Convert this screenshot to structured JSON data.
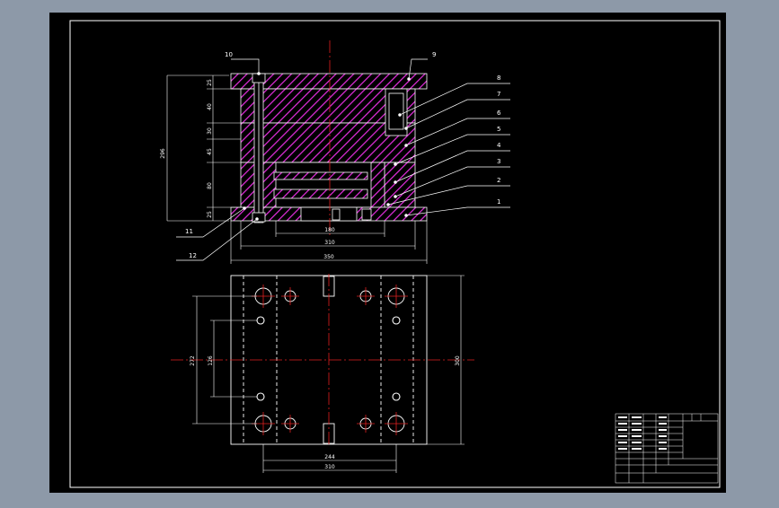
{
  "colors": {
    "background": "#8d99a8",
    "paper": "#000000",
    "line": "#ffffff",
    "hatch": "#e62fe0",
    "centerline": "#e02020",
    "dim": "#ffffff"
  },
  "balloons": [
    "10",
    "9",
    "8",
    "7",
    "6",
    "5",
    "4",
    "3",
    "2",
    "1",
    "11",
    "12"
  ],
  "dims": {
    "overall_height": "296",
    "plate_top": "25",
    "plate_2": "40",
    "plate_3": "30",
    "plate_4": "45",
    "plate_5": "80",
    "plate_6": "25",
    "bottom_w1": "180",
    "bottom_w2": "310",
    "bottom_w3": "350",
    "left_outer": "272",
    "left_inner": "126",
    "right_h": "300",
    "plan_w1": "244",
    "plan_w2": "310"
  },
  "title_block": {
    "rows": [
      "",
      "",
      "",
      "",
      "",
      "",
      "",
      "",
      ""
    ],
    "caption": ""
  }
}
